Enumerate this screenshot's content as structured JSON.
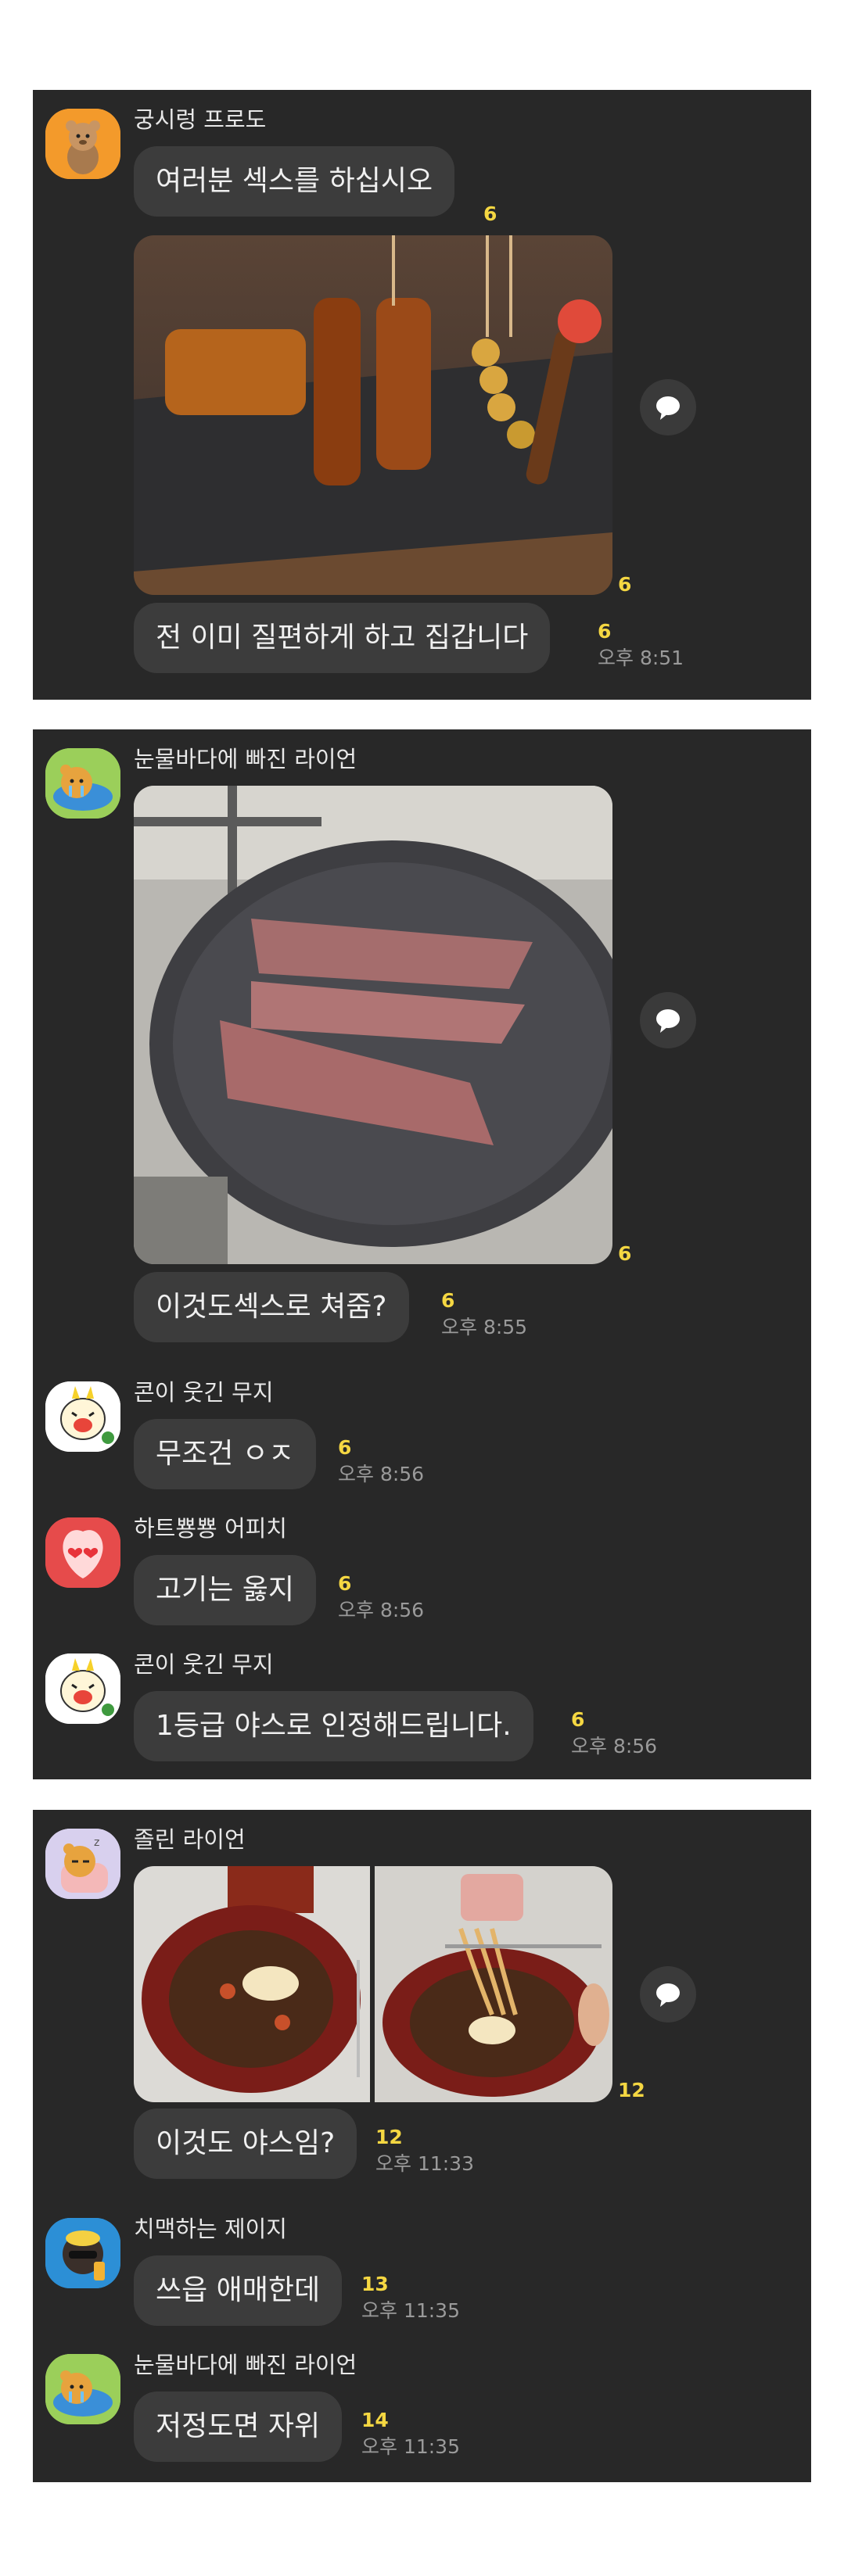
{
  "panel1": {
    "sender": "궁시렁 프로도",
    "message1": "여러분 섹스를 하십시오",
    "message1_count": "6",
    "photo_count": "6",
    "message2": "전 이미 질편하게 하고 집갑니다",
    "message2_count": "6",
    "message2_time": "오후 8:51"
  },
  "panel2": {
    "sender1": "눈물바다에 빠진 라이언",
    "photo_count": "6",
    "message1": "이것도섹스로 쳐줌?",
    "message1_count": "6",
    "message1_time": "오후 8:55",
    "sender2": "콘이 웃긴 무지",
    "message2": "무조건 ㅇㅈ",
    "message2_count": "6",
    "message2_time": "오후 8:56",
    "sender3": "하트뿅뿅 어피치",
    "message3": "고기는 옳지",
    "message3_count": "6",
    "message3_time": "오후 8:56",
    "sender4": "콘이 웃긴 무지",
    "message4": "1등급 야스로 인정해드립니다.",
    "message4_count": "6",
    "message4_time": "오후 8:56"
  },
  "panel3": {
    "sender1": "졸린 라이언",
    "photo_count": "12",
    "message1": "이것도 야스임?",
    "message1_count": "12",
    "message1_time": "오후 11:33",
    "sender2": "치맥하는 제이지",
    "message2": "쓰읍 애매한데",
    "message2_count": "13",
    "message2_time": "오후 11:35",
    "sender3": "눈물바다에 빠진 라이언",
    "message3": "저정도면 자위",
    "message3_count": "14",
    "message3_time": "오후 11:35"
  },
  "icons": {
    "share": "share-speech-bubble-icon",
    "avatars": [
      "frodo-avatar",
      "ryan-tears-avatar",
      "muzi-laugh-avatar",
      "apeach-heart-avatar",
      "ryan-sleepy-avatar",
      "jay-g-avatar"
    ]
  },
  "colors": {
    "panel_bg": "#282828",
    "bubble_bg": "#3c3c3c",
    "count_yellow": "#f5d742",
    "time_gray": "#9a9a9a"
  }
}
